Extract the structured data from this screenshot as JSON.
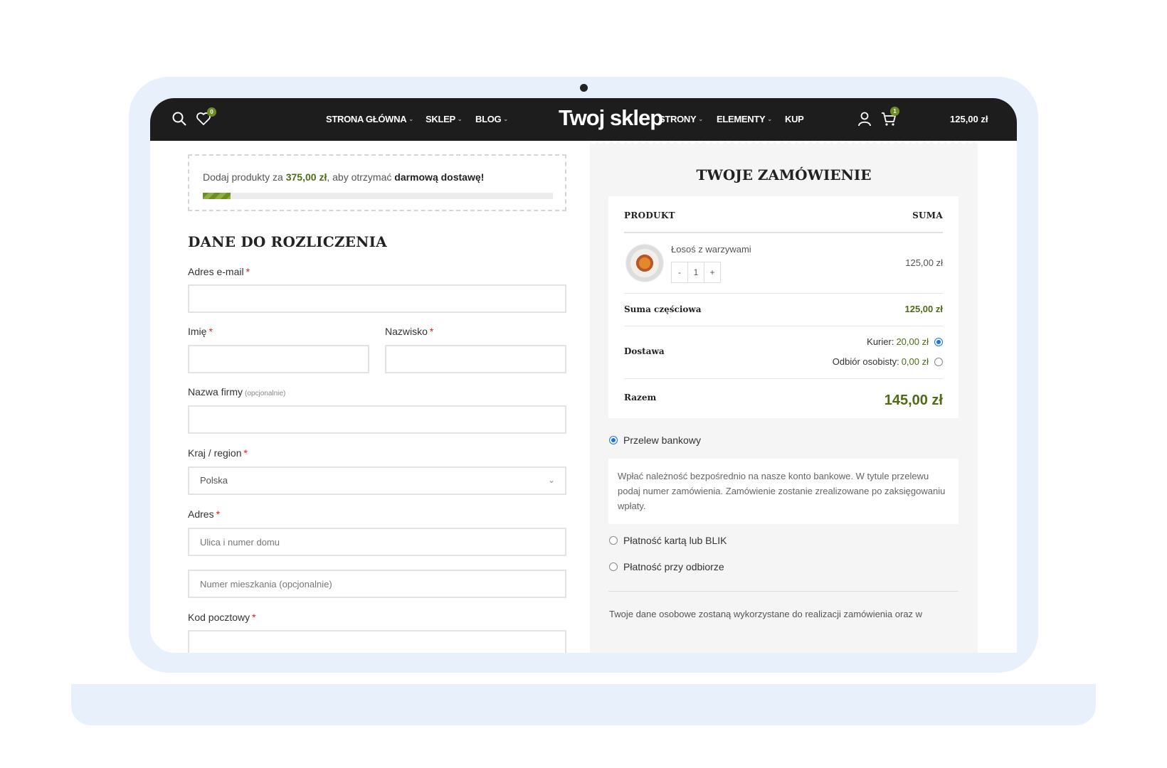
{
  "header": {
    "wishlist_count": "0",
    "nav_left": [
      "STRONA GŁÓWNA",
      "SKLEP",
      "BLOG"
    ],
    "logo": "Twoj sklep",
    "nav_right": [
      "STRONY",
      "ELEMENTY",
      "KUP"
    ],
    "cart_count": "1",
    "cart_total": "125,00 zł"
  },
  "free_shipping": {
    "text_before": "Dodaj produkty za ",
    "amount": "375,00 zł",
    "text_middle": ", aby otrzymać ",
    "text_bold": "darmową dostawę!",
    "progress_fraction": 0.08
  },
  "billing": {
    "title": "DANE DO ROZLICZENIA",
    "required_mark": "*",
    "email_label": "Adres e-mail",
    "first_name_label": "Imię",
    "last_name_label": "Nazwisko",
    "company_label": "Nazwa firmy",
    "optional_note": "(opcjonalnie)",
    "country_label": "Kraj / region",
    "country_value": "Polska",
    "address_label": "Adres",
    "street_placeholder": "Ulica i numer domu",
    "apartment_placeholder": "Numer mieszkania (opcjonalnie)",
    "postcode_label": "Kod pocztowy"
  },
  "order": {
    "title": "TWOJE ZAMÓWIENIE",
    "col_product": "PRODUKT",
    "col_total": "SUMA",
    "product_name": "Łosoś z warzywami",
    "qty_minus": "-",
    "qty_value": "1",
    "qty_plus": "+",
    "product_price": "125,00 zł",
    "subtotal_label": "Suma częściowa",
    "subtotal_value": "125,00 zł",
    "shipping_label": "Dostawa",
    "shipping_option_1_label": "Kurier:",
    "shipping_option_1_value": "20,00 zł",
    "shipping_option_2_label": "Odbiór osobisty:",
    "shipping_option_2_value": "0,00 zł",
    "total_label": "Razem",
    "total_value": "145,00 zł"
  },
  "payment": {
    "bank_transfer": "Przelew bankowy",
    "bank_description": "Wpłać należność bezpośrednio na nasze konto bankowe. W tytule przelewu podaj numer zamówienia. Zamówienie zostanie zrealizowane po zaksięgowaniu wpłaty.",
    "card_blik": "Płatność kartą lub BLIK",
    "cod": "Płatność przy odbiorze",
    "privacy_text": "Twoje dane osobowe zostaną wykorzystane do realizacji zamówienia oraz w"
  },
  "colors": {
    "accent_green": "#4f6b16",
    "header_bg": "#1d1d1d",
    "frame_blue": "#e7f0fb",
    "radio_blue": "#1a73e8"
  }
}
